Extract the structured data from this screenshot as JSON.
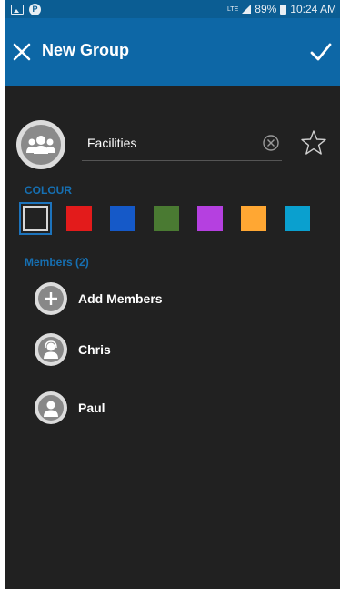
{
  "status_bar": {
    "network": "LTE",
    "battery": "89%",
    "time": "10:24 AM"
  },
  "app_bar": {
    "title": "New Group",
    "close_icon": "close-icon",
    "confirm_icon": "check-icon"
  },
  "group": {
    "name_value": "Facilities",
    "avatar_icon": "group-avatar-icon"
  },
  "colour": {
    "label": "COLOUR",
    "selected_index": 0,
    "swatches": [
      "#222222",
      "#e31b1b",
      "#1559c8",
      "#4a7a32",
      "#b540e0",
      "#ffa733",
      "#0aa0cf"
    ]
  },
  "members": {
    "label": "Members (2)",
    "add_label": "Add Members",
    "items": [
      {
        "name": "Chris"
      },
      {
        "name": "Paul"
      }
    ]
  },
  "colors": {
    "app_bar": "#0d67a6",
    "status_bar": "#0b5d93",
    "background": "#212121",
    "accent_text": "#1670b3"
  }
}
